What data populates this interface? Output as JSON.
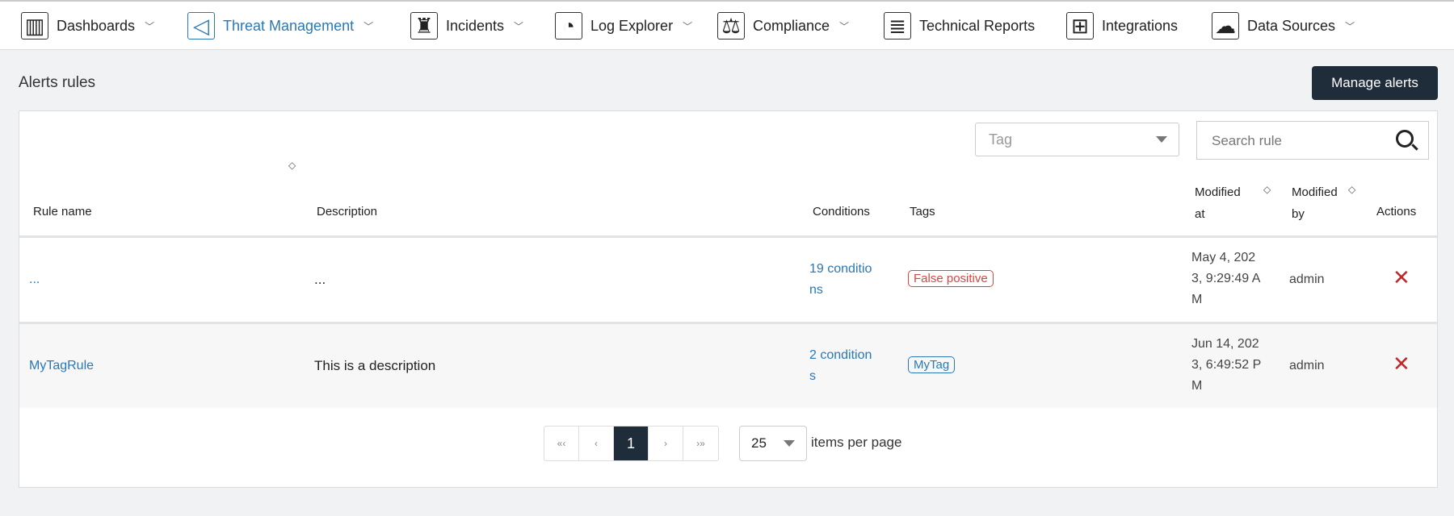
{
  "nav": [
    {
      "label": "Dashboards",
      "icon": "dashboard-icon",
      "glyph": "▥",
      "chevron": true
    },
    {
      "label": "Threat Management",
      "icon": "megaphone-icon",
      "glyph": "◁",
      "chevron": true,
      "active": true
    },
    {
      "label": "Incidents",
      "icon": "lighthouse-icon",
      "glyph": "♜",
      "chevron": true
    },
    {
      "label": "Log Explorer",
      "icon": "magnifier-chart-icon",
      "glyph": "◔",
      "chevron": true
    },
    {
      "label": "Compliance",
      "icon": "scales-icon",
      "glyph": "⚖",
      "chevron": true
    },
    {
      "label": "Technical Reports",
      "icon": "document-icon",
      "glyph": "≣",
      "chevron": false
    },
    {
      "label": "Integrations",
      "icon": "puzzle-icon",
      "glyph": "⊞",
      "chevron": false
    },
    {
      "label": "Data Sources",
      "icon": "cloud-monitor-icon",
      "glyph": "☁",
      "chevron": true
    }
  ],
  "page_title": "Alerts rules",
  "manage_label": "Manage alerts",
  "filters": {
    "tag_placeholder": "Tag",
    "search_placeholder": "Search rule"
  },
  "columns": {
    "rule_name": "Rule name",
    "description": "Description",
    "conditions": "Conditions",
    "tags": "Tags",
    "modified_at_1": "Modified",
    "modified_at_2": "at",
    "modified_by_1": "Modified",
    "modified_by_2": "by",
    "actions": "Actions"
  },
  "rows": [
    {
      "name": "...",
      "description": "...",
      "cond_1": "19 conditio",
      "cond_2": "ns",
      "tag": "False positive",
      "tag_color": "#d9453f",
      "date_1": "May 4, 202",
      "date_2": "3, 9:29:49 A",
      "date_3": "M",
      "by": "admin"
    },
    {
      "name": "MyTagRule",
      "description": "This is a description",
      "cond_1": "2 condition",
      "cond_2": "s",
      "tag": "MyTag",
      "tag_color": "#2a78b5",
      "date_1": "Jun 14, 202",
      "date_2": "3, 6:49:52 P",
      "date_3": "M",
      "by": "admin"
    }
  ],
  "pagination": {
    "first": "«‹",
    "prev": "‹",
    "current": "1",
    "next": "›",
    "last": "›»",
    "per_page": "25",
    "per_page_label": "items per page"
  }
}
